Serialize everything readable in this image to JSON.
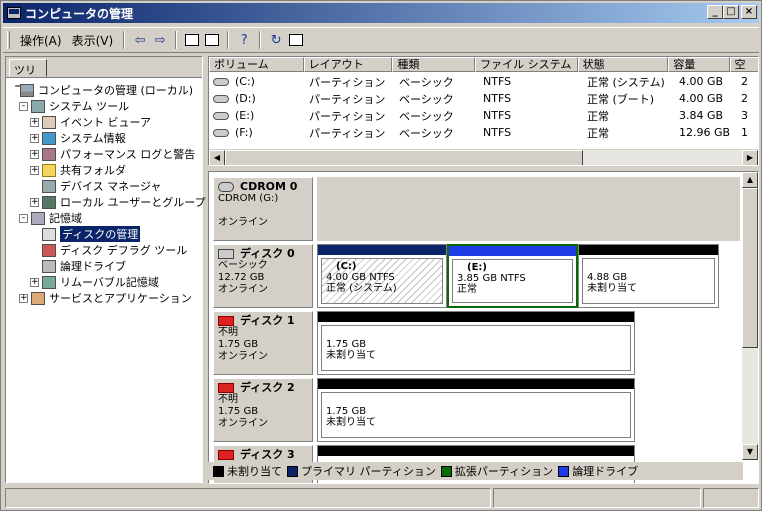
{
  "window": {
    "title": "コンピュータの管理"
  },
  "toolbar": {
    "menu_action": "操作(A)",
    "menu_view": "表示(V)"
  },
  "tree": {
    "tab": "ツリー",
    "items": [
      {
        "label": "コンピュータの管理 (ローカル)",
        "level": 0,
        "exp": "",
        "icon": "computer"
      },
      {
        "label": "システム ツール",
        "level": 1,
        "exp": "-",
        "icon": "tools"
      },
      {
        "label": "イベント ビューア",
        "level": 2,
        "exp": "+",
        "icon": "event"
      },
      {
        "label": "システム情報",
        "level": 2,
        "exp": "+",
        "icon": "info"
      },
      {
        "label": "パフォーマンス ログと警告",
        "level": 2,
        "exp": "+",
        "icon": "perf"
      },
      {
        "label": "共有フォルダ",
        "level": 2,
        "exp": "+",
        "icon": "folder"
      },
      {
        "label": "デバイス マネージャ",
        "level": 2,
        "exp": "",
        "icon": "device"
      },
      {
        "label": "ローカル ユーザーとグループ",
        "level": 2,
        "exp": "+",
        "icon": "users"
      },
      {
        "label": "記憶域",
        "level": 1,
        "exp": "-",
        "icon": "storage"
      },
      {
        "label": "ディスクの管理",
        "level": 2,
        "exp": "",
        "icon": "disk",
        "selected": true
      },
      {
        "label": "ディスク デフラグ ツール",
        "level": 2,
        "exp": "",
        "icon": "defrag"
      },
      {
        "label": "論理ドライブ",
        "level": 2,
        "exp": "",
        "icon": "logical"
      },
      {
        "label": "リムーバブル記憶域",
        "level": 2,
        "exp": "+",
        "icon": "removable"
      },
      {
        "label": "サービスとアプリケーション",
        "level": 1,
        "exp": "+",
        "icon": "services"
      }
    ]
  },
  "volumes": {
    "headers": [
      "ボリューム",
      "レイアウト",
      "種類",
      "ファイル システム",
      "状態",
      "容量",
      "空"
    ],
    "rows": [
      [
        "(C:)",
        "パーティション",
        "ベーシック",
        "NTFS",
        "正常 (システム)",
        "4.00 GB",
        "2"
      ],
      [
        "(D:)",
        "パーティション",
        "ベーシック",
        "NTFS",
        "正常 (ブート)",
        "4.00 GB",
        "2"
      ],
      [
        "(E:)",
        "パーティション",
        "ベーシック",
        "NTFS",
        "正常",
        "3.84 GB",
        "3"
      ],
      [
        "(F:)",
        "パーティション",
        "ベーシック",
        "NTFS",
        "正常",
        "12.96 GB",
        "1"
      ]
    ]
  },
  "disks": {
    "cdrom0": {
      "name": "CDROM 0",
      "l1": "CDROM (G:)",
      "l2": "",
      "l3": "オンライン"
    },
    "disk0": {
      "name": "ディスク 0",
      "l1": "ベーシック",
      "l2": "12.72 GB",
      "l3": "オンライン",
      "parts": [
        {
          "name": "(C:)",
          "size": "4.00 GB NTFS",
          "status": "正常 (システム)"
        },
        {
          "name": "(E:)",
          "size": "3.85 GB NTFS",
          "status": "正常"
        },
        {
          "name": "",
          "size": "4.88 GB",
          "status": "未割り当て"
        }
      ]
    },
    "disk1": {
      "name": "ディスク 1",
      "l1": "不明",
      "l2": "1.75 GB",
      "l3": "オンライン",
      "size": "1.75 GB",
      "status": "未割り当て"
    },
    "disk2": {
      "name": "ディスク 2",
      "l1": "不明",
      "l2": "1.75 GB",
      "l3": "オンライン",
      "size": "1.75 GB",
      "status": "未割り当て"
    },
    "disk3": {
      "name": "ディスク 3"
    }
  },
  "legend": {
    "items": [
      {
        "label": "未割り当て",
        "color": "#000000"
      },
      {
        "label": "プライマリ パーティション",
        "color": "#0a246a"
      },
      {
        "label": "拡張パーティション",
        "color": "#0a6a0a"
      },
      {
        "label": "論理ドライブ",
        "color": "#1e3ce6"
      }
    ]
  }
}
